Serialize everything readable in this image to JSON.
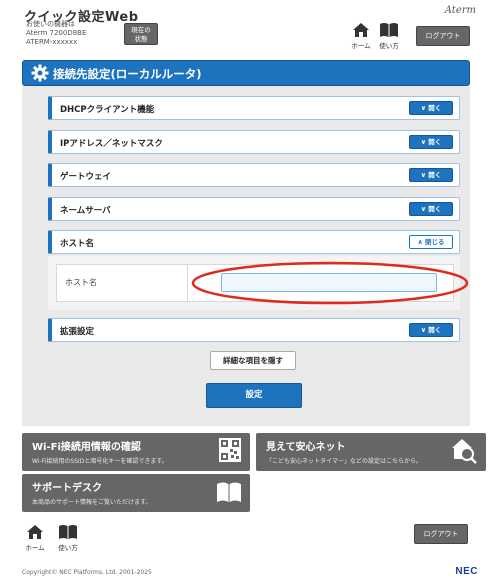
{
  "header": {
    "title": "クイック設定Web",
    "device_line1": "お使いの機器は",
    "device_line2": "Aterm 7200D8BE",
    "device_line3": "ATERM-xxxxxx",
    "status_line1": "現在の",
    "status_line2": "状態",
    "home_label": "ホーム",
    "usage_label": "使い方",
    "logo": "Aterm",
    "logout_label": "ログアウト"
  },
  "section": {
    "title": "接続先設定(ローカルルータ)"
  },
  "accordions": {
    "dhcp": {
      "label": "DHCPクライアント機能",
      "toggle": "開く"
    },
    "ip": {
      "label": "IPアドレス／ネットマスク",
      "toggle": "開く"
    },
    "gateway": {
      "label": "ゲートウェイ",
      "toggle": "開く"
    },
    "nameserver": {
      "label": "ネームサーバ",
      "toggle": "開く"
    },
    "hostname": {
      "label": "ホスト名",
      "toggle": "閉じる"
    },
    "extended": {
      "label": "拡張設定",
      "toggle": "開く"
    }
  },
  "hostname_form": {
    "label": "ホスト名",
    "value": "",
    "placeholder": ""
  },
  "buttons": {
    "hide_details": "詳細な項目を隠す",
    "apply": "設定"
  },
  "cards": {
    "wifi": {
      "title": "Wi-Fi接続用情報の確認",
      "desc": "Wi-Fi接続用のSSIDと暗号化キーを確認できます。",
      "icon": "qr-code-icon"
    },
    "safety": {
      "title": "見えて安心ネット",
      "desc": "「こども安心ネットタイマー」などの設定はこちらから。",
      "icon": "home-search-icon"
    },
    "support": {
      "title": "サポートデスク",
      "desc": "本商品のサポート情報をご覧いただけます。",
      "icon": "book-icon"
    }
  },
  "footer": {
    "home_label": "ホーム",
    "usage_label": "使い方",
    "logout_label": "ログアウト",
    "copyright": "Copyright© NEC Platforms, Ltd. 2001-2025",
    "brand": "NEC"
  },
  "colors": {
    "primary": "#1e73be",
    "dark_button": "#666666",
    "panel_bg": "#e9e9e9",
    "highlight_ring": "#e02a1b"
  }
}
